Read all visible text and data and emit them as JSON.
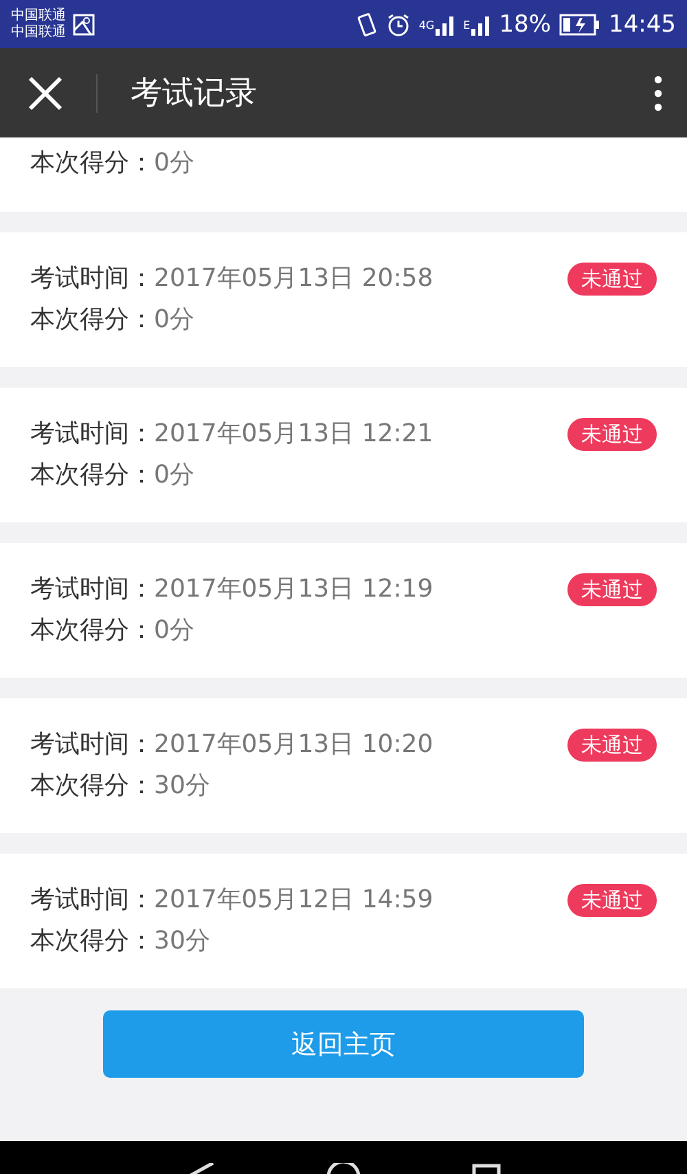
{
  "status_bar": {
    "carriers": [
      "中国联通",
      "中国联通"
    ],
    "network": "4G",
    "network_2": "E",
    "battery": "18%",
    "time": "14:45"
  },
  "app_bar": {
    "title": "考试记录"
  },
  "records": [
    {
      "score_label": "本次得分：",
      "score": "0分"
    },
    {
      "time_label": "考试时间：",
      "time": "2017年05月13日 20:58",
      "score_label": "本次得分：",
      "score": "0分",
      "status": "未通过"
    },
    {
      "time_label": "考试时间：",
      "time": "2017年05月13日 12:21",
      "score_label": "本次得分：",
      "score": "0分",
      "status": "未通过"
    },
    {
      "time_label": "考试时间：",
      "time": "2017年05月13日 12:19",
      "score_label": "本次得分：",
      "score": "0分",
      "status": "未通过"
    },
    {
      "time_label": "考试时间：",
      "time": "2017年05月13日 10:20",
      "score_label": "本次得分：",
      "score": "30分",
      "status": "未通过"
    },
    {
      "time_label": "考试时间：",
      "time": "2017年05月12日 14:59",
      "score_label": "本次得分：",
      "score": "30分",
      "status": "未通过"
    }
  ],
  "home_button": "返回主页"
}
